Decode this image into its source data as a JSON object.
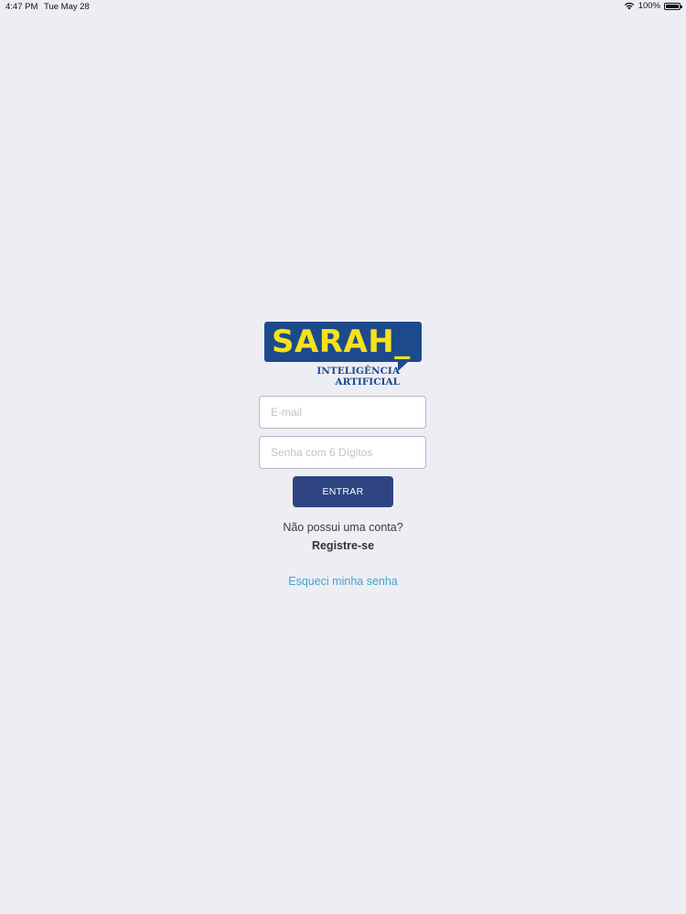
{
  "status_bar": {
    "time": "4:47 PM",
    "date": "Tue May 28",
    "battery": "100%",
    "battery_level": 1.0,
    "icons": [
      "wifi-icon",
      "battery-icon"
    ]
  },
  "logo": {
    "wordmark": "SARAH_",
    "subtitle_line1": "INTELIGÊNCIA",
    "subtitle_line2": "ARTIFICIAL",
    "colors": {
      "box": "#1d4a8c",
      "wordmark": "#f6e11a"
    }
  },
  "form": {
    "email_placeholder": "E-mail",
    "email_value": "",
    "password_placeholder": "Senha com 6 Dígitos",
    "password_value": "",
    "submit_label": "ENTRAR"
  },
  "footer": {
    "no_account_text": "Não possui uma conta?",
    "register_label": "Registre-se",
    "forgot_password_label": "Esqueci minha senha"
  },
  "colors": {
    "background": "#ededf4",
    "button": "#2f4582",
    "link": "#3fa6cd"
  }
}
